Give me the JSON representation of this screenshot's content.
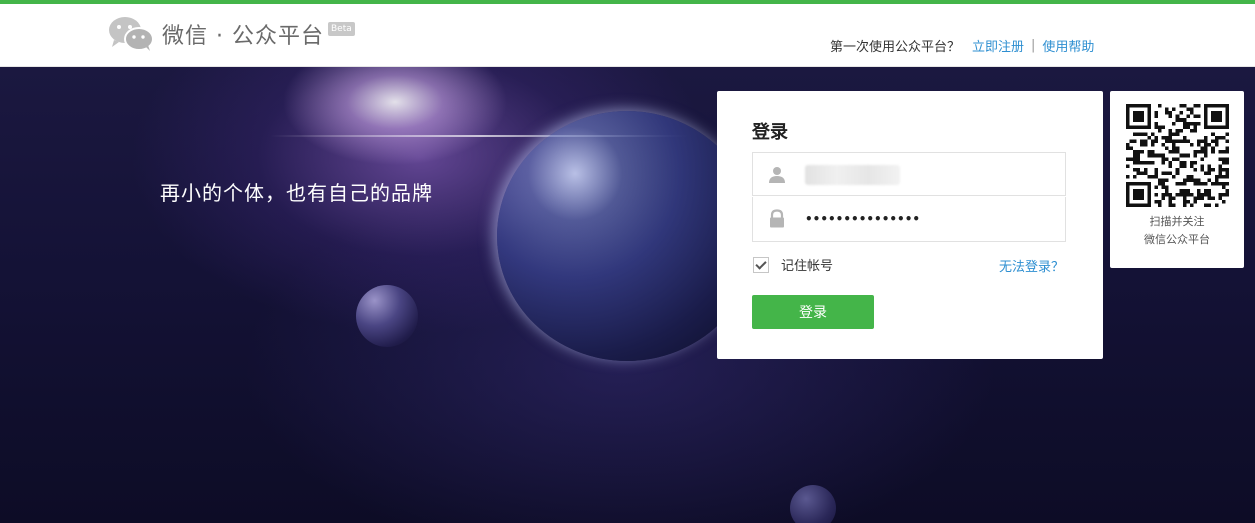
{
  "top_strip_color": "#44b549",
  "header": {
    "logo_text": "微信 · 公众平台",
    "beta_badge": "Beta",
    "first_time_text": "第一次使用公众平台？",
    "register_link": "立即注册",
    "separator": "|",
    "help_link": "使用帮助",
    "link_color": "#2e8fd1"
  },
  "hero": {
    "slogan": "再小的个体，也有自己的品牌"
  },
  "login": {
    "title": "登录",
    "username_value": "",
    "password_value": "•••••••••••••••",
    "remember_label": "记住帐号",
    "remember_checked": true,
    "forgot_link": "无法登录？",
    "submit_label": "登录",
    "button_color": "#44b549"
  },
  "qr": {
    "caption_line1": "扫描并关注",
    "caption_line2": "微信公众平台"
  }
}
